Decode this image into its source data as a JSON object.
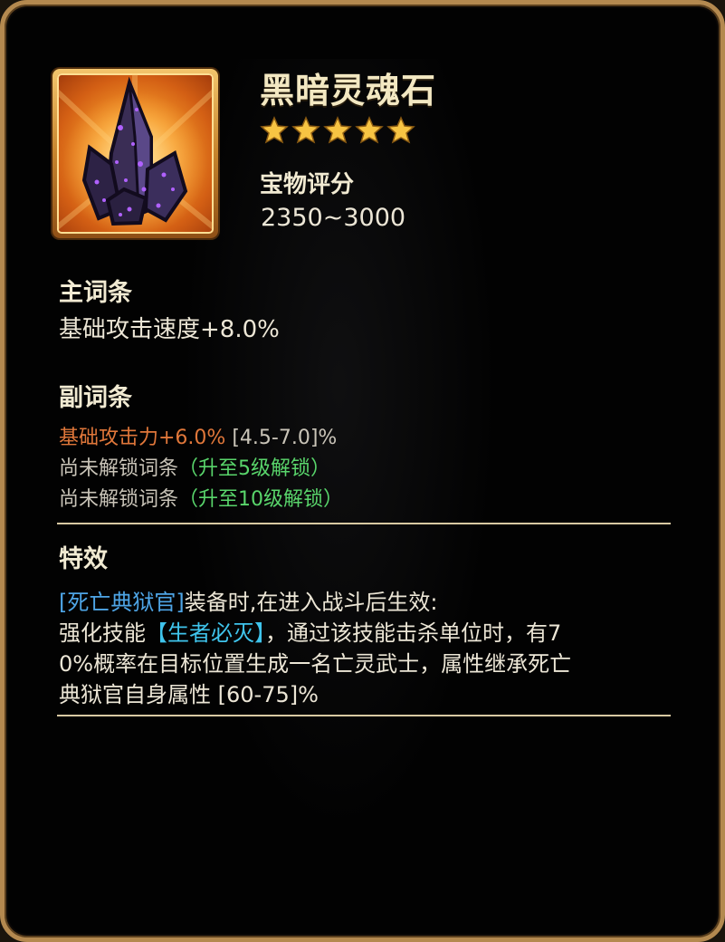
{
  "item": {
    "name": "黑暗灵魂石",
    "star_count": 5,
    "score_label": "宝物评分",
    "score_range": "2350~3000",
    "icon_name": "dark-crystal-icon"
  },
  "main_affix": {
    "heading": "主词条",
    "text": "基础攻击速度+8.0%"
  },
  "sub_affix": {
    "heading": "副词条",
    "stat_value": "基础攻击力+6.0%",
    "stat_range": " [4.5-7.0]%",
    "locked": [
      {
        "text": "尚未解锁词条",
        "unlock": "（升至5级解锁）"
      },
      {
        "text": "尚未解锁词条",
        "unlock": "（升至10级解锁）"
      }
    ]
  },
  "special": {
    "heading": "特效",
    "line1_hero": "[死亡典狱官]",
    "line1_rest": "装备时,在进入战斗后生效:",
    "line2_pre": "强化技能",
    "line2_skill": "【生者必灭】",
    "line2_post": "，通过该技能击杀单位时，有7",
    "line3": "0%概率在目标位置生成一名亡灵武士，属性继承死亡",
    "line4": "典狱官自身属性 [60-75]%"
  },
  "colors": {
    "frame_gold": "#b4894f",
    "title": "#f3e8c2",
    "orange_stat": "#e0773a",
    "green_unlock": "#59d56b",
    "blue_hero": "#4ea5e6",
    "star": "#f7c443"
  }
}
